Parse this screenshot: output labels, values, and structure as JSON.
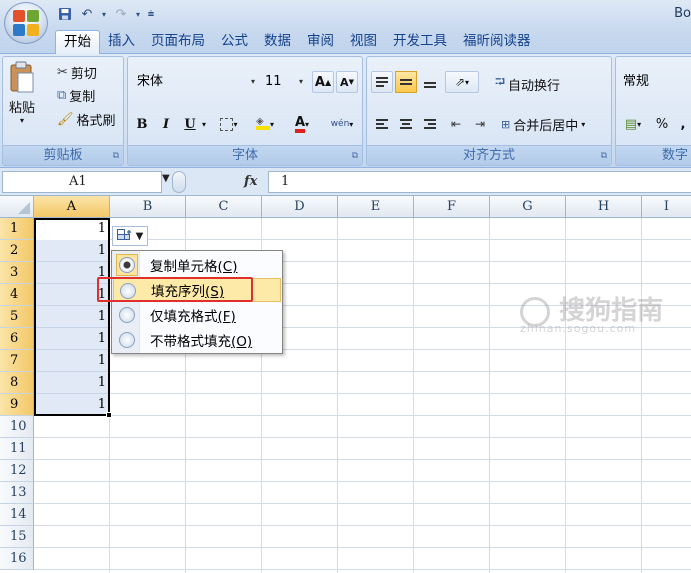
{
  "window": {
    "title": "Bo"
  },
  "tabs": [
    "开始",
    "插入",
    "页面布局",
    "公式",
    "数据",
    "审阅",
    "视图",
    "开发工具",
    "福昕阅读器"
  ],
  "clipboard": {
    "paste": "粘贴",
    "cut": "剪切",
    "copy": "复制",
    "format_painter": "格式刷",
    "group_label": "剪贴板"
  },
  "font": {
    "name": "宋体",
    "size": "11",
    "bold": "B",
    "italic": "I",
    "underline": "U",
    "phonetic": "wén",
    "grow": "A",
    "shrink": "A",
    "group_label": "字体"
  },
  "alignment": {
    "wrap_text": "自动换行",
    "merge_center": "合并后居中",
    "group_label": "对齐方式"
  },
  "number": {
    "format": "常规",
    "percent": "%",
    "group_label": "数字"
  },
  "formula_bar": {
    "name_box": "A1",
    "fx": "fx",
    "value": "1"
  },
  "columns": [
    "A",
    "B",
    "C",
    "D",
    "E",
    "F",
    "G",
    "H",
    "I"
  ],
  "rows": [
    "1",
    "2",
    "3",
    "4",
    "5",
    "6",
    "7",
    "8",
    "9",
    "10",
    "11",
    "12",
    "13",
    "14",
    "15",
    "16"
  ],
  "column_a_values": [
    "1",
    "1",
    "1",
    "1",
    "1",
    "1",
    "1",
    "1",
    "1"
  ],
  "autofill_menu": {
    "items": [
      {
        "label": "复制单元格",
        "hotkey": "(C)",
        "checked": true
      },
      {
        "label": "填充序列",
        "hotkey": "(S)",
        "checked": false
      },
      {
        "label": "仅填充格式",
        "hotkey": "(F)",
        "checked": false
      },
      {
        "label": "不带格式填充",
        "hotkey": "(O)",
        "checked": false
      }
    ]
  },
  "watermark": {
    "text": "搜狗指南",
    "url": "zhinan.sogou.com"
  },
  "colors": {
    "selection_highlight": "#f3c867",
    "callout_border": "#e0302d",
    "ribbon_blue": "#dfeaf7"
  }
}
